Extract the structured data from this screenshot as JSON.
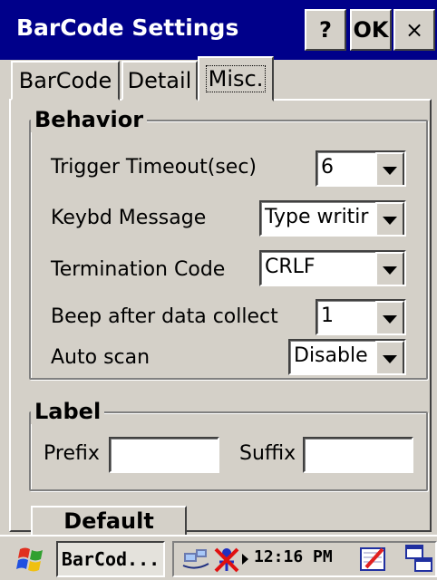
{
  "window": {
    "title": "BarCode Settings",
    "help_label": "?",
    "ok_label": "OK",
    "close_label": "×"
  },
  "tabs": [
    {
      "label": "BarCode",
      "active": false
    },
    {
      "label": "Detail",
      "active": false
    },
    {
      "label": "Misc.",
      "active": true
    }
  ],
  "behavior": {
    "legend": "Behavior",
    "rows": [
      {
        "label": "Trigger Timeout(sec)",
        "value": "6"
      },
      {
        "label": "Keybd Message",
        "value": "Type writir"
      },
      {
        "label": "Termination Code",
        "value": "CRLF"
      },
      {
        "label": "Beep after data collect",
        "value": "1"
      },
      {
        "label": "Auto scan",
        "value": "Disable"
      }
    ]
  },
  "label_group": {
    "legend": "Label",
    "prefix_label": "Prefix",
    "prefix_value": "",
    "suffix_label": "Suffix",
    "suffix_value": ""
  },
  "default_button": "Default",
  "taskbar": {
    "task_label": "BarCod...",
    "clock": "12:16 PM",
    "icons": [
      "windows-start-icon",
      "network-icon",
      "disconnect-icon",
      "input-panel-icon",
      "switch-window-icon"
    ]
  },
  "colors": {
    "titlebar": "#00008a",
    "face": "#d4d0c8"
  }
}
